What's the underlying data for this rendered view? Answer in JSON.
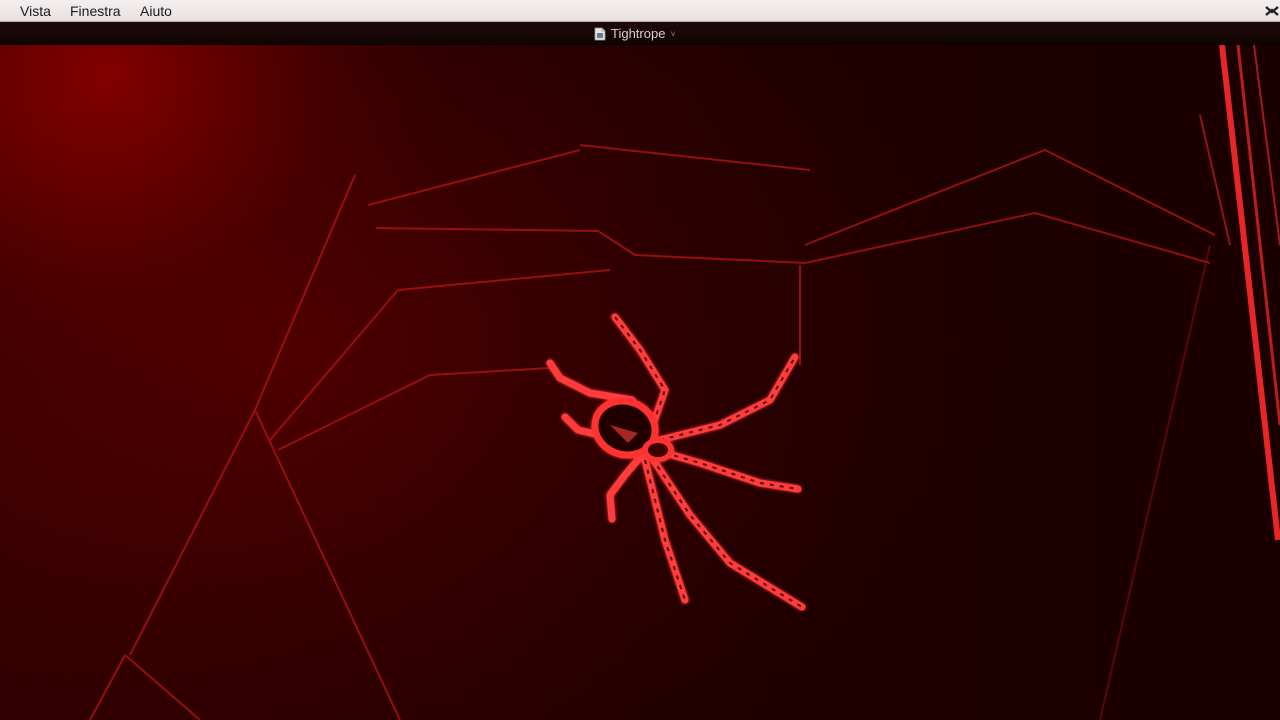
{
  "menubar": {
    "items": [
      {
        "label": "Vista"
      },
      {
        "label": "Finestra"
      },
      {
        "label": "Aiuto"
      }
    ]
  },
  "window": {
    "title": "Tightrope",
    "title_chevron": "˅"
  },
  "media": {
    "description_icon": "spider-image",
    "tint_color": "#e01a1a"
  },
  "colors": {
    "menubar_bg": "#ece5e5",
    "titlebar_bg": "#170707",
    "web_strand": "#b31616",
    "spider_glow": "#ff3030"
  }
}
